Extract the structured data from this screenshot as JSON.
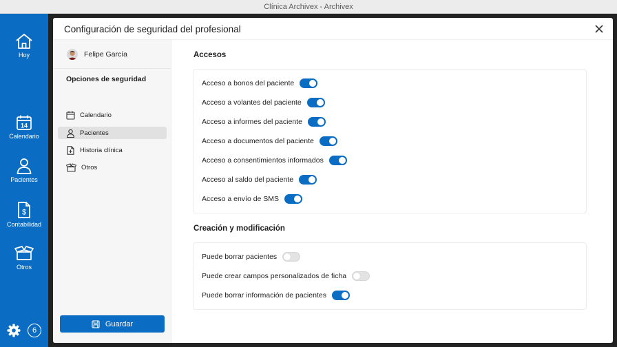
{
  "window": {
    "title": "Clínica Archivex - Archivex"
  },
  "nav": {
    "items": [
      {
        "id": "hoy",
        "label": "Hoy",
        "icon": "home-icon"
      },
      {
        "id": "calendario",
        "label": "Calendario",
        "icon": "calendar-icon",
        "day": "14"
      },
      {
        "id": "pacientes",
        "label": "Pacientes",
        "icon": "person-icon"
      },
      {
        "id": "contabilidad",
        "label": "Contabilidad",
        "icon": "invoice-icon"
      },
      {
        "id": "otros",
        "label": "Otros",
        "icon": "box-icon"
      }
    ],
    "notifications": "6"
  },
  "modal": {
    "title": "Configuración de seguridad del profesional",
    "user_name": "Felipe García",
    "section_heading": "Opciones de seguridad",
    "menu": [
      {
        "label": "Calendario",
        "icon": "calendar-icon",
        "active": false
      },
      {
        "label": "Pacientes",
        "icon": "person-icon",
        "active": true
      },
      {
        "label": "Historia clínica",
        "icon": "document-icon",
        "active": false
      },
      {
        "label": "Otros",
        "icon": "box-icon",
        "active": false
      }
    ],
    "save_label": "Guardar"
  },
  "groups": [
    {
      "title": "Accesos",
      "items": [
        {
          "label": "Acceso a bonos del paciente",
          "on": true
        },
        {
          "label": "Acceso a volantes del paciente",
          "on": true
        },
        {
          "label": "Acceso a informes del paciente",
          "on": true
        },
        {
          "label": "Acceso a documentos del paciente",
          "on": true
        },
        {
          "label": "Acceso a consentimientos informados",
          "on": true
        },
        {
          "label": "Acceso al saldo del paciente",
          "on": true
        },
        {
          "label": "Acceso a envío de SMS",
          "on": true
        }
      ]
    },
    {
      "title": "Creación y modificación",
      "items": [
        {
          "label": "Puede borrar pacientes",
          "on": false
        },
        {
          "label": "Puede crear campos personalizados de ficha",
          "on": false
        },
        {
          "label": "Puede borrar información de pacientes",
          "on": true
        }
      ]
    }
  ],
  "colors": {
    "accent": "#0a6cc2",
    "nav_bg": "#0a6cc2",
    "toggle_off": "#e3e3e3"
  }
}
